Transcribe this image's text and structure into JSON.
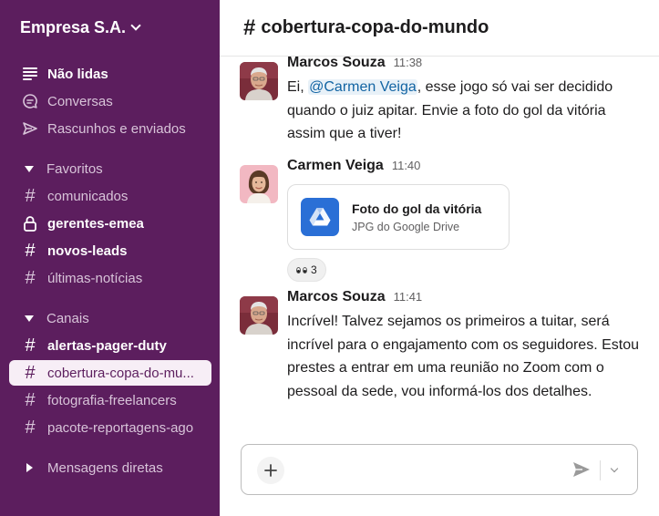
{
  "workspace": {
    "name": "Empresa S.A."
  },
  "sidebar": {
    "top_items": [
      {
        "label": "Não lidas",
        "icon": "unread-icon",
        "bold": true
      },
      {
        "label": "Conversas",
        "icon": "threads-icon",
        "bold": false
      },
      {
        "label": "Rascunhos e enviados",
        "icon": "send-icon",
        "bold": false
      }
    ],
    "favorites": {
      "title": "Favoritos",
      "items": [
        {
          "label": "comunicados",
          "icon": "hash-icon",
          "bold": false
        },
        {
          "label": "gerentes-emea",
          "icon": "lock-icon",
          "bold": true
        },
        {
          "label": "novos-leads",
          "icon": "hash-icon",
          "bold": true
        },
        {
          "label": "últimas-notícias",
          "icon": "hash-icon",
          "bold": false
        }
      ]
    },
    "channels": {
      "title": "Canais",
      "items": [
        {
          "label": "alertas-pager-duty",
          "bold": true,
          "active": false
        },
        {
          "label": "cobertura-copa-do-mu...",
          "bold": false,
          "active": true
        },
        {
          "label": "fotografia-freelancers",
          "bold": false,
          "active": false
        },
        {
          "label": "pacote-reportagens-ago",
          "bold": false,
          "active": false
        }
      ]
    },
    "dms": {
      "title": "Mensagens diretas"
    },
    "colors": {
      "background": "#5c1e5e",
      "active_bg": "#f7eef6"
    }
  },
  "channel": {
    "hash": "#",
    "name": "cobertura-copa-do-mundo"
  },
  "messages": [
    {
      "author": "Marcos Souza",
      "time": "11:38",
      "text_before": "Ei, ",
      "mention": "@Carmen Veiga",
      "text_after": ", esse jogo só vai ser decidido quando o juiz apitar. Envie a foto do gol da vitória assim que a tiver!"
    },
    {
      "author": "Carmen Veiga",
      "time": "11:40",
      "file": {
        "title": "Foto do gol da vitória",
        "subtitle": "JPG do Google Drive",
        "icon": "google-drive-icon"
      },
      "reaction": {
        "emoji": "eyes",
        "count": "3"
      }
    },
    {
      "author": "Marcos Souza",
      "time": "11:41",
      "text": "Incrível! Talvez sejamos os primeiros a tuitar, será incrível para o engajamento com os seguidores. Estou prestes a entrar em uma reunião no Zoom com o pessoal da sede, vou informá-los dos detalhes."
    }
  ],
  "composer": {
    "placeholder": ""
  }
}
